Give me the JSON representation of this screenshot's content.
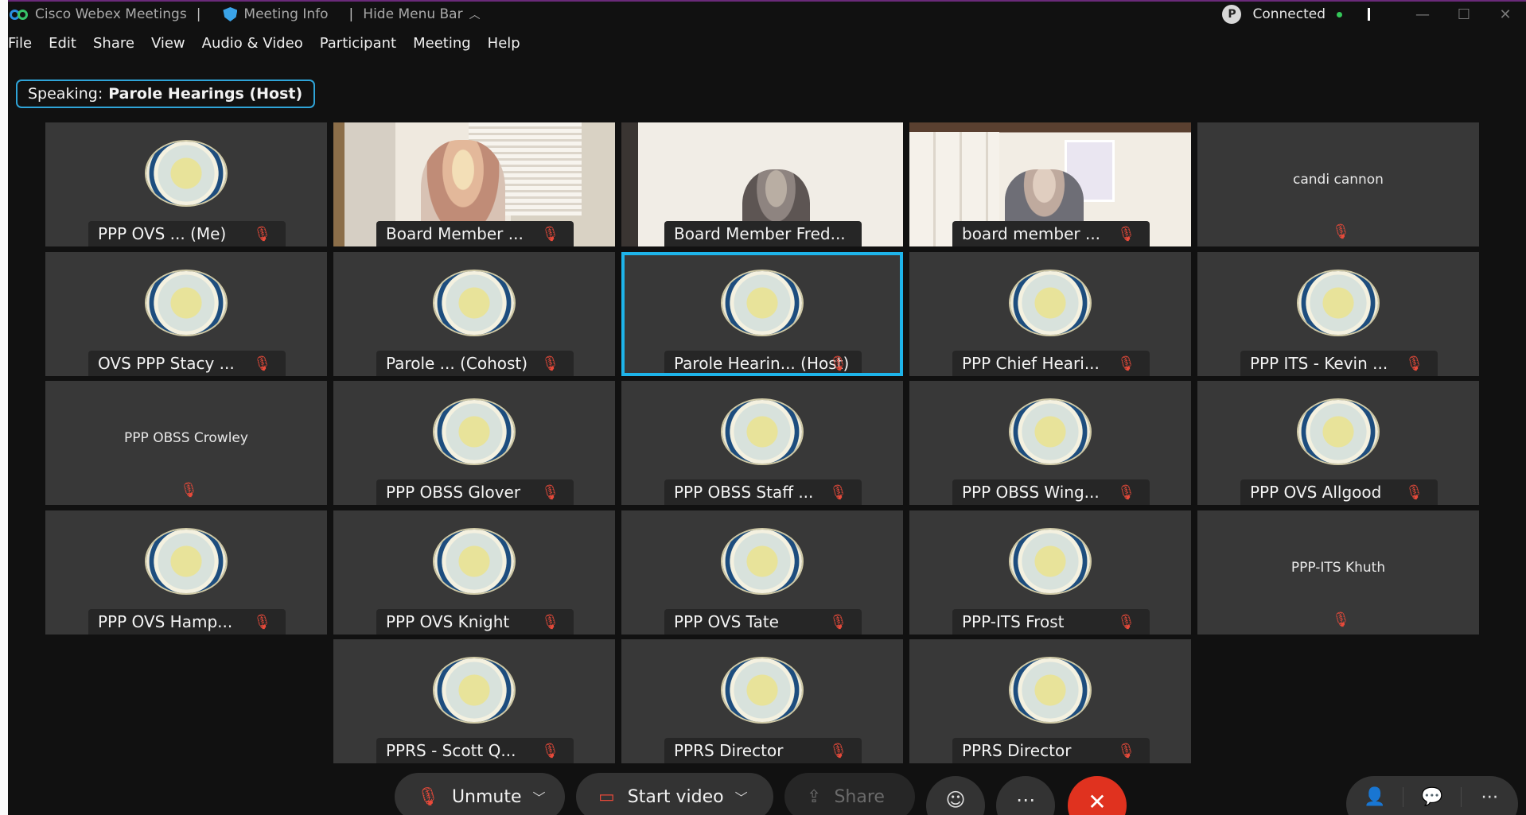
{
  "titlebar": {
    "app_name": "Cisco Webex Meetings",
    "meeting_info": "Meeting Info",
    "hide_menu_bar": "Hide Menu Bar",
    "status": "Connected"
  },
  "menu": [
    "File",
    "Edit",
    "Share",
    "View",
    "Audio & Video",
    "Participant",
    "Meeting",
    "Help"
  ],
  "speaking": {
    "label": "Speaking:",
    "name": "Parole Hearings (Host)"
  },
  "tiles": [
    {
      "name": "PPP OVS ... (Me)",
      "kind": "seal"
    },
    {
      "name": "Board Member ...",
      "kind": "video1"
    },
    {
      "name": "Board Member Fred...",
      "kind": "video2"
    },
    {
      "name": "board member ...",
      "kind": "video3"
    },
    {
      "name": "candi cannon",
      "kind": "nameonly"
    },
    {
      "name": "OVS PPP Stacy ...",
      "kind": "seal"
    },
    {
      "name": "Parole ... (Cohost)",
      "kind": "seal"
    },
    {
      "name": "Parole Hearin... (Host)",
      "kind": "seal",
      "active": true
    },
    {
      "name": "PPP Chief Heari...",
      "kind": "seal"
    },
    {
      "name": "PPP ITS - Kevin ...",
      "kind": "seal"
    },
    {
      "name": "PPP OBSS Crowley",
      "kind": "nameonly"
    },
    {
      "name": "PPP OBSS Glover",
      "kind": "seal"
    },
    {
      "name": "PPP OBSS Staff ...",
      "kind": "seal"
    },
    {
      "name": "PPP OBSS Wing...",
      "kind": "seal"
    },
    {
      "name": "PPP OVS Allgood",
      "kind": "seal"
    },
    {
      "name": "PPP OVS Hamp...",
      "kind": "seal"
    },
    {
      "name": "PPP OVS Knight",
      "kind": "seal"
    },
    {
      "name": "PPP OVS Tate",
      "kind": "seal"
    },
    {
      "name": "PPP-ITS Frost",
      "kind": "seal"
    },
    {
      "name": "PPP-ITS Khuth",
      "kind": "nameonly"
    },
    {
      "name": "PPRS - Scott Q...",
      "kind": "seal"
    },
    {
      "name": "PPRS Director",
      "kind": "seal"
    },
    {
      "name": "PPRS Director",
      "kind": "seal"
    }
  ],
  "toolbar": {
    "unmute": "Unmute",
    "start_video": "Start video",
    "share": "Share"
  },
  "colors": {
    "accent": "#1eb4ea",
    "end_call": "#e0321f",
    "muted": "#e84a3a",
    "connected": "#34c759"
  }
}
